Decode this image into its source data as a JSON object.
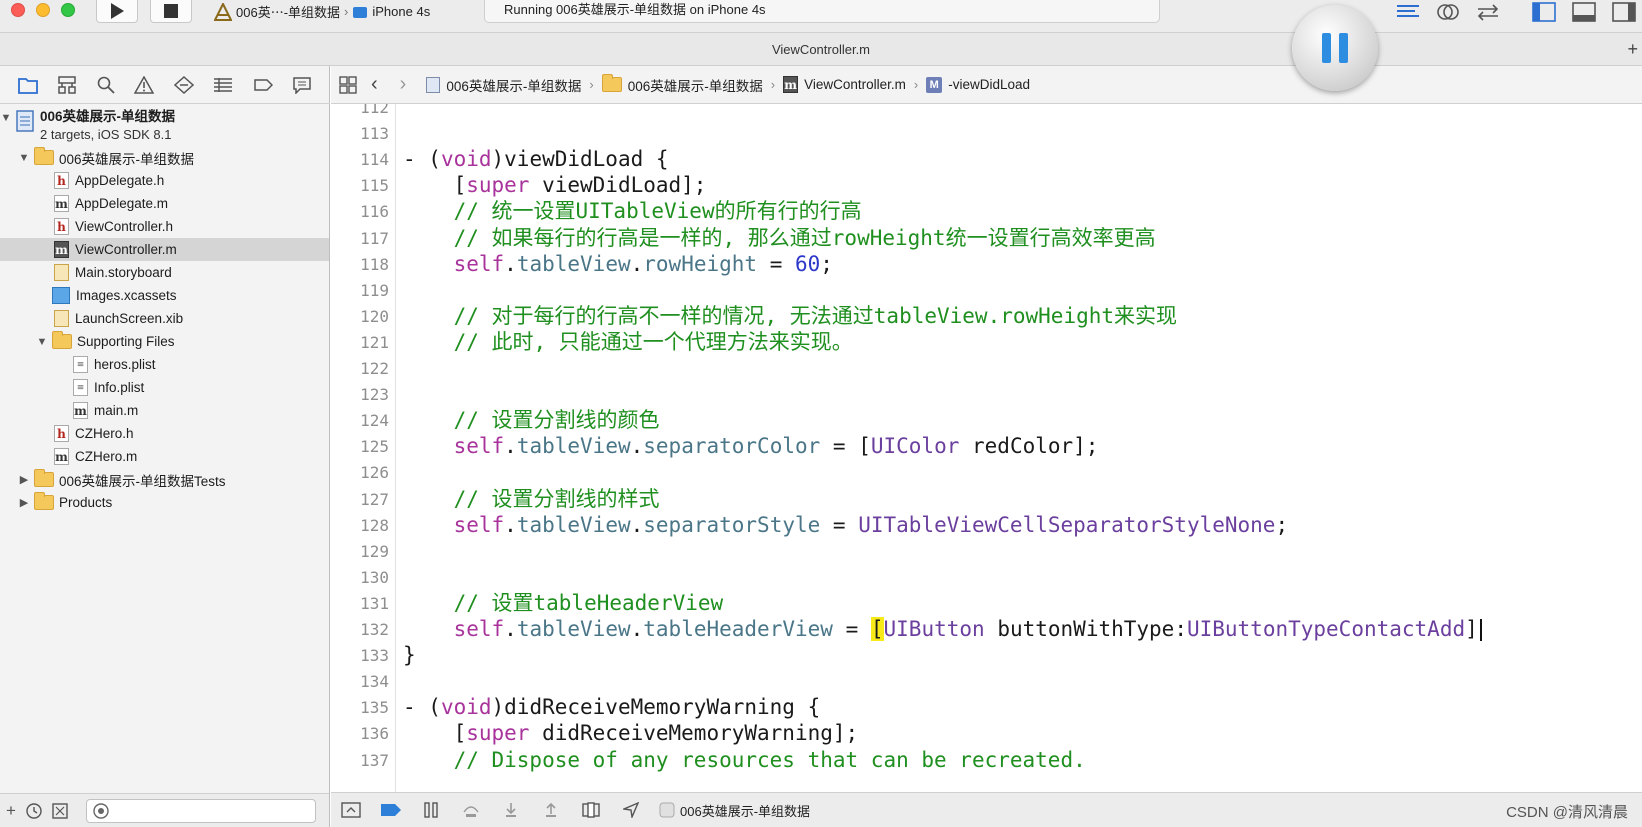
{
  "toolbar": {
    "scheme_name": "006英⋯-单组数据",
    "device_name": "iPhone 4s",
    "activity_status": "Running 006英雄展示-单组数据 on iPhone 4s"
  },
  "window": {
    "title": "ViewController.m"
  },
  "navigator": {
    "project": {
      "name": "006英雄展示-单组数据",
      "subtitle": "2 targets, iOS SDK 8.1"
    },
    "items": [
      {
        "label": "006英雄展示-单组数据",
        "kind": "folder",
        "indent": 1,
        "expanded": true
      },
      {
        "label": "AppDelegate.h",
        "kind": "h",
        "indent": 2
      },
      {
        "label": "AppDelegate.m",
        "kind": "m",
        "indent": 2
      },
      {
        "label": "ViewController.h",
        "kind": "h",
        "indent": 2
      },
      {
        "label": "ViewController.m",
        "kind": "m",
        "indent": 2,
        "selected": true
      },
      {
        "label": "Main.storyboard",
        "kind": "storyboard",
        "indent": 2
      },
      {
        "label": "Images.xcassets",
        "kind": "assets",
        "indent": 2
      },
      {
        "label": "LaunchScreen.xib",
        "kind": "xib",
        "indent": 2
      },
      {
        "label": "Supporting Files",
        "kind": "folder",
        "indent": 2,
        "expanded": true
      },
      {
        "label": "heros.plist",
        "kind": "plist",
        "indent": 3
      },
      {
        "label": "Info.plist",
        "kind": "plist",
        "indent": 3
      },
      {
        "label": "main.m",
        "kind": "m",
        "indent": 3
      },
      {
        "label": "CZHero.h",
        "kind": "h",
        "indent": 2
      },
      {
        "label": "CZHero.m",
        "kind": "m",
        "indent": 2
      },
      {
        "label": "006英雄展示-单组数据Tests",
        "kind": "folder",
        "indent": 1,
        "expanded": false
      },
      {
        "label": "Products",
        "kind": "folder",
        "indent": 1,
        "expanded": false
      }
    ]
  },
  "jumpbar": {
    "crumbs": [
      "006英雄展示-单组数据",
      "006英雄展示-单组数据",
      "ViewController.m",
      "-viewDidLoad"
    ],
    "method_badge": "M"
  },
  "editor": {
    "lines": [
      {
        "n": "112",
        "text": ""
      },
      {
        "n": "113",
        "text": ""
      },
      {
        "n": "114",
        "text": "- (void)viewDidLoad {"
      },
      {
        "n": "115",
        "text": "    [super viewDidLoad];"
      },
      {
        "n": "116",
        "text": "    // 统一设置UITableView的所有行的行高"
      },
      {
        "n": "117",
        "text": "    // 如果每行的行高是一样的, 那么通过rowHeight统一设置行高效率更高"
      },
      {
        "n": "118",
        "text": "    self.tableView.rowHeight = 60;"
      },
      {
        "n": "119",
        "text": ""
      },
      {
        "n": "120",
        "text": "    // 对于每行的行高不一样的情况, 无法通过tableView.rowHeight来实现"
      },
      {
        "n": "121",
        "text": "    // 此时, 只能通过一个代理方法来实现。"
      },
      {
        "n": "122",
        "text": ""
      },
      {
        "n": "123",
        "text": ""
      },
      {
        "n": "124",
        "text": "    // 设置分割线的颜色"
      },
      {
        "n": "125",
        "text": "    self.tableView.separatorColor = [UIColor redColor];"
      },
      {
        "n": "126",
        "text": ""
      },
      {
        "n": "127",
        "text": "    // 设置分割线的样式"
      },
      {
        "n": "128",
        "text": "    self.tableView.separatorStyle = UITableViewCellSeparatorStyleNone;"
      },
      {
        "n": "129",
        "text": ""
      },
      {
        "n": "130",
        "text": ""
      },
      {
        "n": "131",
        "text": "    // 设置tableHeaderView"
      },
      {
        "n": "132",
        "text": "    self.tableView.tableHeaderView = [UIButton buttonWithType:UIButtonTypeContactAdd]"
      },
      {
        "n": "133",
        "text": "}"
      },
      {
        "n": "134",
        "text": ""
      },
      {
        "n": "135",
        "text": "- (void)didReceiveMemoryWarning {"
      },
      {
        "n": "136",
        "text": "    [super didReceiveMemoryWarning];"
      },
      {
        "n": "137",
        "text": "    // Dispose of any resources that can be recreated."
      }
    ]
  },
  "debugbar": {
    "process_label": "006英雄展示-单组数据"
  },
  "watermark": "CSDN @清风清晨",
  "colors": {
    "keyword": "#a8339b",
    "comment": "#1f8f1f",
    "number": "#2c38c9",
    "property": "#4a7688",
    "class": "#6b3f9e",
    "bracket_highlight": "#f8ea18",
    "accent": "#2d8de0"
  }
}
